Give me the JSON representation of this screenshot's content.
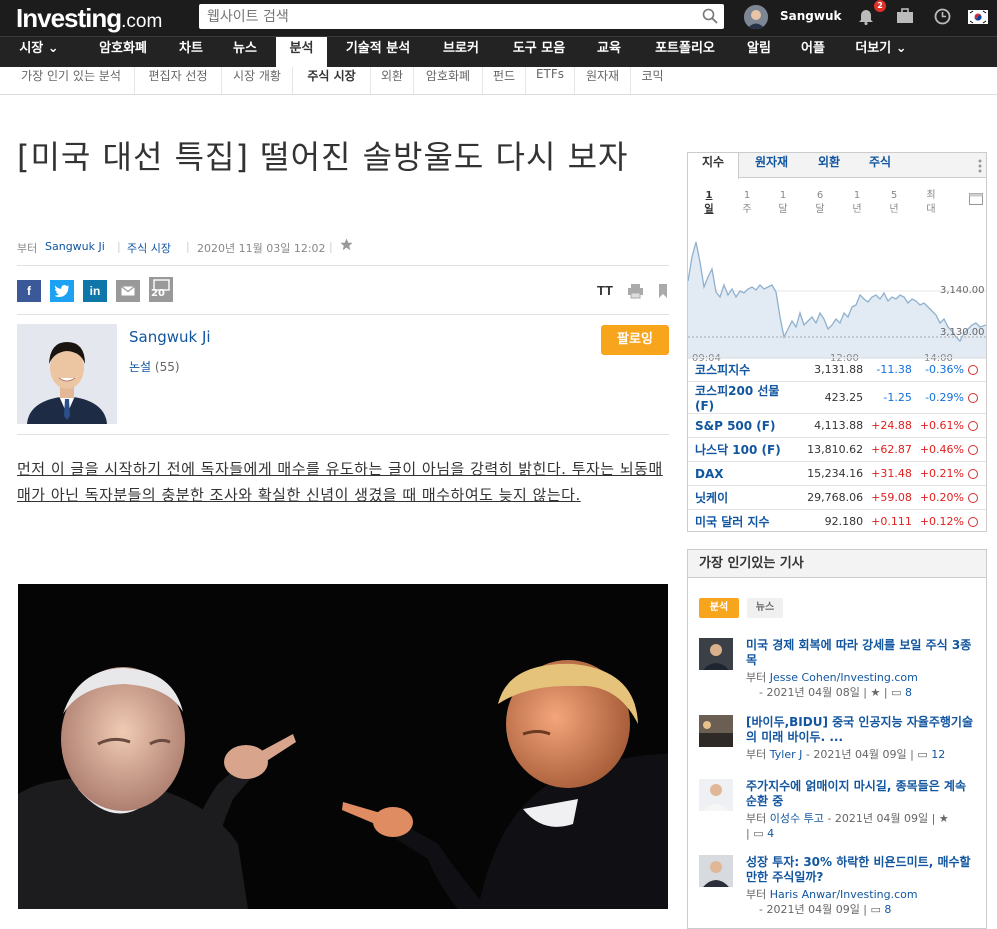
{
  "header": {
    "logo_main": "Investing",
    "logo_suffix": ".com",
    "search_placeholder": "웹사이트 검색",
    "username": "Sangwuk",
    "notification_count": "2"
  },
  "nav": {
    "items": [
      {
        "label": "시장 ⌄"
      },
      {
        "label": "암호화폐"
      },
      {
        "label": "차트"
      },
      {
        "label": "뉴스"
      },
      {
        "label": "분석"
      },
      {
        "label": "기술적 분석"
      },
      {
        "label": "브로커"
      },
      {
        "label": "도구 모음"
      },
      {
        "label": "교육"
      },
      {
        "label": "포트폴리오"
      },
      {
        "label": "알림"
      },
      {
        "label": "어플"
      },
      {
        "label": "더보기 ⌄"
      }
    ]
  },
  "subnav": {
    "items": [
      {
        "label": "가장 인기 있는 분석"
      },
      {
        "label": "편집자 선정"
      },
      {
        "label": "시장 개황"
      },
      {
        "label": "주식 시장"
      },
      {
        "label": "외환"
      },
      {
        "label": "암호화폐"
      },
      {
        "label": "펀드"
      },
      {
        "label": "ETFs"
      },
      {
        "label": "원자재"
      },
      {
        "label": "코믹"
      }
    ]
  },
  "article": {
    "title": "[미국 대선 특집] 떨어진 솔방울도 다시 보자",
    "by_prefix": "부터",
    "author": "Sangwuk Ji",
    "category": "주식 시장",
    "date": "2020년 11월 03일 12:02",
    "comment_count": "20",
    "font_toggle": "TT",
    "author_name": "Sangwuk Ji",
    "author_posts_label": "논설",
    "author_posts_count": "(55)",
    "follow_label": "팔로잉",
    "intro": "먼저 이 글을 시작하기 전에 독자들에게 매수를 유도하는 글이 아님을 강력히 밝힌다. 투자는 뇌동매매가 아닌 독자분들의 충분한 조사와 확실한 신념이 생겼을 때 매수하여도 늦지 않는다."
  },
  "markets": {
    "tabs": [
      {
        "label": "지수"
      },
      {
        "label": "원자재"
      },
      {
        "label": "외환"
      },
      {
        "label": "주식"
      }
    ],
    "periods": [
      {
        "line1": "1",
        "line2": "일"
      },
      {
        "line1": "1",
        "line2": "주"
      },
      {
        "line1": "1",
        "line2": "달"
      },
      {
        "line1": "6",
        "line2": "달"
      },
      {
        "line1": "1",
        "line2": "년"
      },
      {
        "line1": "5",
        "line2": "년"
      },
      {
        "line1": "최",
        "line2": "대"
      }
    ],
    "chart": {
      "y_labels": [
        "3,140.00",
        "3,130.00"
      ],
      "x_labels": [
        "09:04",
        "12:00",
        "14:00"
      ]
    },
    "rows": [
      {
        "name": "코스피지수",
        "value": "3,131.88",
        "change": "-11.38",
        "pct": "-0.36%",
        "dir": "down"
      },
      {
        "name": "코스피200 선물 (F)",
        "value": "423.25",
        "change": "-1.25",
        "pct": "-0.29%",
        "dir": "down"
      },
      {
        "name": "S&P 500 (F)",
        "value": "4,113.88",
        "change": "+24.88",
        "pct": "+0.61%",
        "dir": "up"
      },
      {
        "name": "나스닥 100 (F)",
        "value": "13,810.62",
        "change": "+62.87",
        "pct": "+0.46%",
        "dir": "up"
      },
      {
        "name": "DAX",
        "value": "15,234.16",
        "change": "+31.48",
        "pct": "+0.21%",
        "dir": "up"
      },
      {
        "name": "닛케이",
        "value": "29,768.06",
        "change": "+59.08",
        "pct": "+0.20%",
        "dir": "up"
      },
      {
        "name": "미국 달러 지수",
        "value": "92.180",
        "change": "+0.111",
        "pct": "+0.12%",
        "dir": "up"
      }
    ]
  },
  "popular": {
    "title": "가장 인기있는 기사",
    "tab_active": "분석",
    "tab_other": "뉴스",
    "articles": [
      {
        "title": "미국 경제 회복에 따라 강세를 보일 주식 3종목",
        "by": "부터",
        "author": "Jesse Cohen/Investing.com",
        "date": "2021년 04월 08일",
        "comments": "8"
      },
      {
        "title": "[바이두,BIDU] 중국 인공지능 자율주행기술의 미래 바이두. ...",
        "by": "부터",
        "author": "Tyler J",
        "date": "2021년 04월 09일",
        "comments": "12"
      },
      {
        "title": "주가지수에 얽매이지 마시길, 종목들은 계속 순환 중",
        "by": "부터",
        "author": "이성수 투고",
        "date": "2021년 04월 09일",
        "comments": "4"
      },
      {
        "title": "성장 투자: 30% 하락한 비욘드미트, 매수할 만한 주식일까?",
        "by": "부터",
        "author": "Haris Anwar/Investing.com",
        "date": "2021년 04월 09일",
        "comments": "8"
      }
    ]
  },
  "colors": {
    "accent": "#f8a51e",
    "link": "#1256a0",
    "up": "#e02020",
    "down": "#1470d8"
  }
}
